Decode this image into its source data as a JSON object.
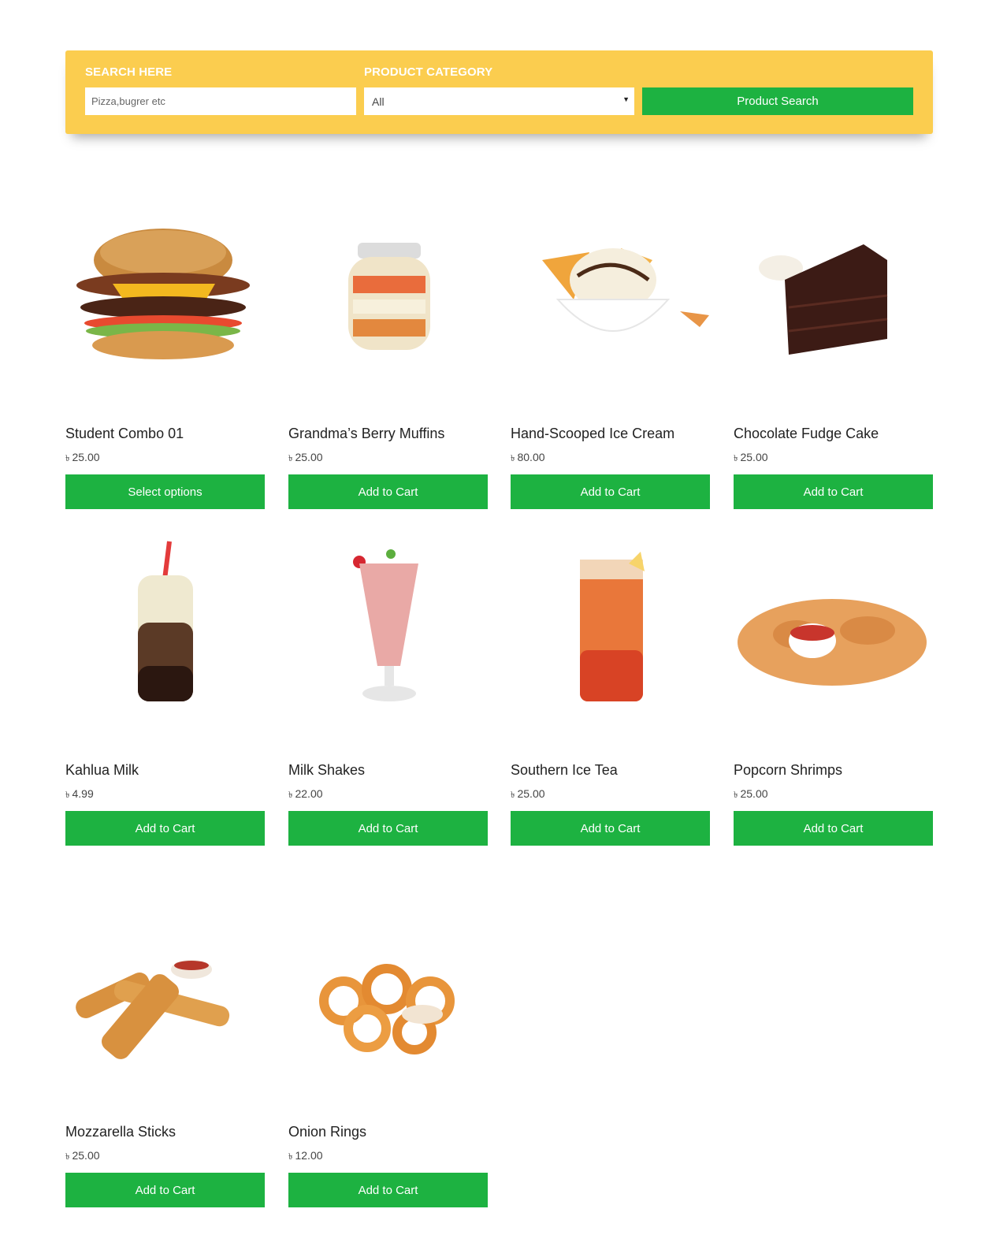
{
  "search": {
    "search_label": "SEARCH HERE",
    "search_placeholder": "Pizza,bugrer etc",
    "category_label": "PRODUCT CATEGORY",
    "category_selected": "All",
    "button_label": "Product Search"
  },
  "currency_symbol": "৳",
  "products": [
    {
      "name": "Student Combo 01",
      "price": "25.00",
      "button": "Select options",
      "icon": "burger-image"
    },
    {
      "name": "Grandma’s Berry Muffins",
      "price": "25.00",
      "button": "Add to Cart",
      "icon": "berry-jar-image"
    },
    {
      "name": "Hand-Scooped Ice Cream",
      "price": "80.00",
      "button": "Add to Cart",
      "icon": "ice-cream-bowl-image"
    },
    {
      "name": "Chocolate Fudge Cake",
      "price": "25.00",
      "button": "Add to Cart",
      "icon": "chocolate-cake-image"
    },
    {
      "name": "Kahlua Milk",
      "price": "4.99",
      "button": "Add to Cart",
      "icon": "kahlua-milk-image"
    },
    {
      "name": "Milk Shakes",
      "price": "22.00",
      "button": "Add to Cart",
      "icon": "milkshake-image"
    },
    {
      "name": "Southern Ice Tea",
      "price": "25.00",
      "button": "Add to Cart",
      "icon": "ice-tea-image"
    },
    {
      "name": "Popcorn Shrimps",
      "price": "25.00",
      "button": "Add to Cart",
      "icon": "popcorn-shrimp-image"
    },
    {
      "name": "Mozzarella Sticks",
      "price": "25.00",
      "button": "Add to Cart",
      "icon": "mozzarella-sticks-image"
    },
    {
      "name": "Onion Rings",
      "price": "12.00",
      "button": "Add to Cart",
      "icon": "onion-rings-image"
    }
  ],
  "colors": {
    "accent_green": "#1db241",
    "panel_yellow": "#fbcd4f"
  }
}
